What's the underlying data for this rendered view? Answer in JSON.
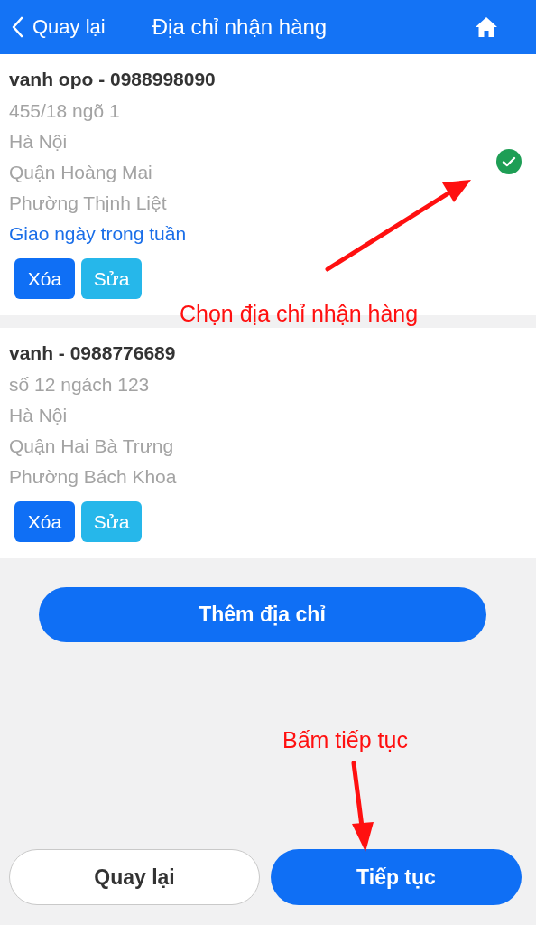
{
  "header": {
    "back_label": "Quay lại",
    "title": "Địa chỉ nhận hàng"
  },
  "addresses": [
    {
      "name_phone": "vanh opo - 0988998090",
      "lines": [
        "455/18 ngõ 1",
        "Hà Nội",
        "Quận Hoàng Mai",
        "Phường Thịnh Liệt"
      ],
      "note": "Giao ngày trong tuần",
      "selected": true,
      "buttons": [
        "Xóa",
        "Sửa"
      ]
    },
    {
      "name_phone": "vanh - 0988776689",
      "lines": [
        "số 12 ngách 123",
        "Hà Nội",
        "Quận Hai Bà Trưng",
        "Phường Bách Khoa"
      ],
      "selected": false,
      "buttons": [
        "Xóa",
        "Sửa"
      ]
    }
  ],
  "add_button": "Thêm địa chỉ",
  "footer_buttons": [
    {
      "label": "Quay lại",
      "kind": "secondary"
    },
    {
      "label": "Tiếp tục",
      "kind": "primary"
    }
  ],
  "annotations": [
    {
      "text": "Chọn địa chỉ nhận hàng"
    },
    {
      "text": "Bấm tiếp tục"
    }
  ]
}
